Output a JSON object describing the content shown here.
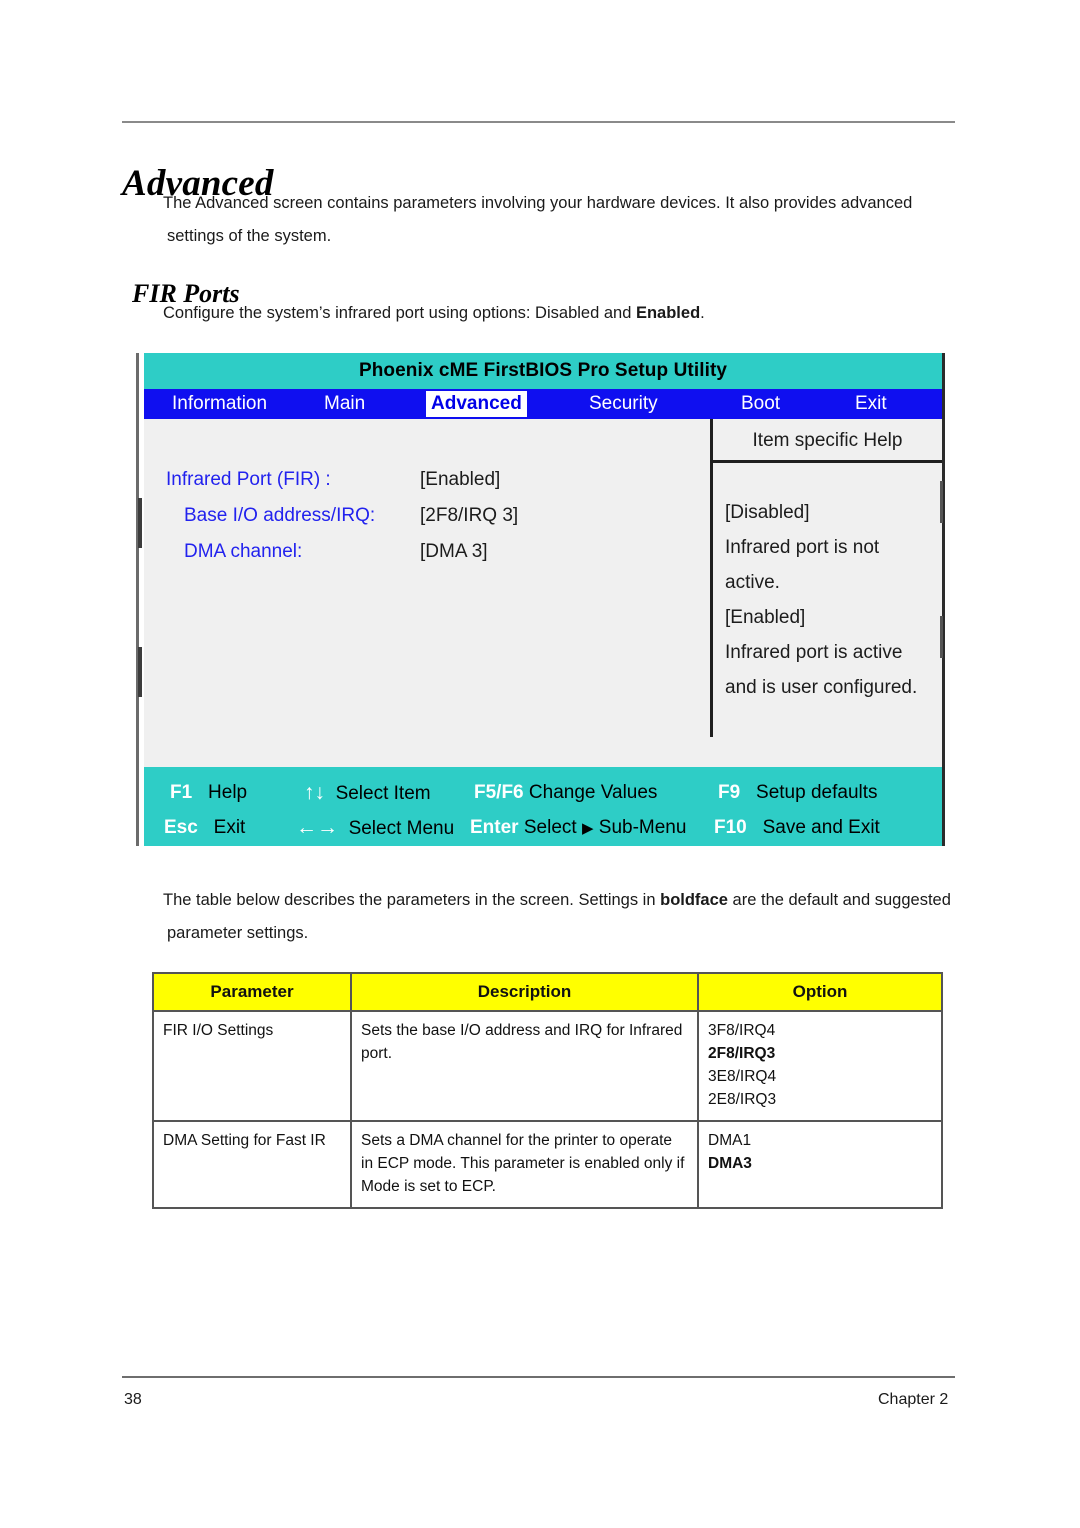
{
  "document": {
    "heading": "Advanced",
    "intro_paragraph_line1": "The Advanced screen contains parameters involving your hardware devices. It also provides advanced",
    "intro_paragraph_line2": "settings of the system.",
    "subheading": "FIR Ports",
    "subheading_paragraph_prefix": "Configure the system’s infrared port using options: Disabled and ",
    "subheading_paragraph_bold": "Enabled",
    "subheading_paragraph_suffix": ".",
    "table_intro_prefix": "The table below describes the parameters in the screen. Settings in ",
    "table_intro_bold": "boldface",
    "table_intro_suffix": " are the default and suggested",
    "table_intro_line2": "parameter settings."
  },
  "bios": {
    "title": "Phoenix cME FirstBIOS Pro Setup Utility",
    "menu": [
      {
        "label": "Information",
        "active": false
      },
      {
        "label": "Main",
        "active": false
      },
      {
        "label": "Advanced",
        "active": true
      },
      {
        "label": "Security",
        "active": false
      },
      {
        "label": "Boot",
        "active": false
      },
      {
        "label": "Exit",
        "active": false
      }
    ],
    "settings": [
      {
        "label": "Infrared Port (FIR) :",
        "value": "[Enabled]"
      },
      {
        "label": "Base I/O address/IRQ:",
        "value": "[2F8/IRQ 3]"
      },
      {
        "label": "DMA channel:",
        "value": "[DMA 3]"
      }
    ],
    "help": {
      "title": "Item specific Help",
      "lines": [
        "[Disabled]",
        "Infrared port is not",
        "active.",
        "[Enabled]",
        "Infrared port is active",
        "and is user configured."
      ]
    },
    "keys_row1": [
      {
        "name": "F1",
        "desc": "Help"
      },
      {
        "arrow": "↑↓",
        "desc": "Select Item"
      },
      {
        "name": "F5/F6",
        "desc": "Change Values"
      },
      {
        "name": "F9",
        "desc": "Setup defaults"
      }
    ],
    "keys_row2": [
      {
        "name": "Esc",
        "desc": "Exit"
      },
      {
        "arrow": "←→",
        "desc": "Select Menu"
      },
      {
        "name": "Enter",
        "desc": "Select",
        "tri": "▶",
        "desc2": "Sub-Menu"
      },
      {
        "name": "F10",
        "desc": "Save and Exit"
      }
    ],
    "colors": {
      "title_bar": "#2ecdc6",
      "menu_bar": "#0f0ff0",
      "active_tab_text": "#0000e8",
      "setting_label": "#2222ee",
      "screen_bg": "#f0f0f0",
      "key_bar": "#2ecdc6"
    }
  },
  "table": {
    "headers": [
      "Parameter",
      "Description",
      "Option"
    ],
    "header_bg": "#ffff00",
    "rows": [
      {
        "parameter": "FIR I/O Settings",
        "description": "Sets the base I/O address and IRQ for Infrared port.",
        "options": [
          {
            "text": "3F8/IRQ4",
            "bold": false
          },
          {
            "text": "2F8/IRQ3",
            "bold": true
          },
          {
            "text": "3E8/IRQ4",
            "bold": false
          },
          {
            "text": "2E8/IRQ3",
            "bold": false
          }
        ]
      },
      {
        "parameter": "DMA Setting for Fast IR",
        "description": "Sets a DMA channel for the printer to operate in ECP mode. This parameter is enabled only if Mode is set to ECP.",
        "options": [
          {
            "text": "DMA1",
            "bold": false
          },
          {
            "text": "DMA3",
            "bold": true
          }
        ]
      }
    ]
  },
  "footer": {
    "page_number": "38",
    "chapter": "Chapter 2"
  }
}
